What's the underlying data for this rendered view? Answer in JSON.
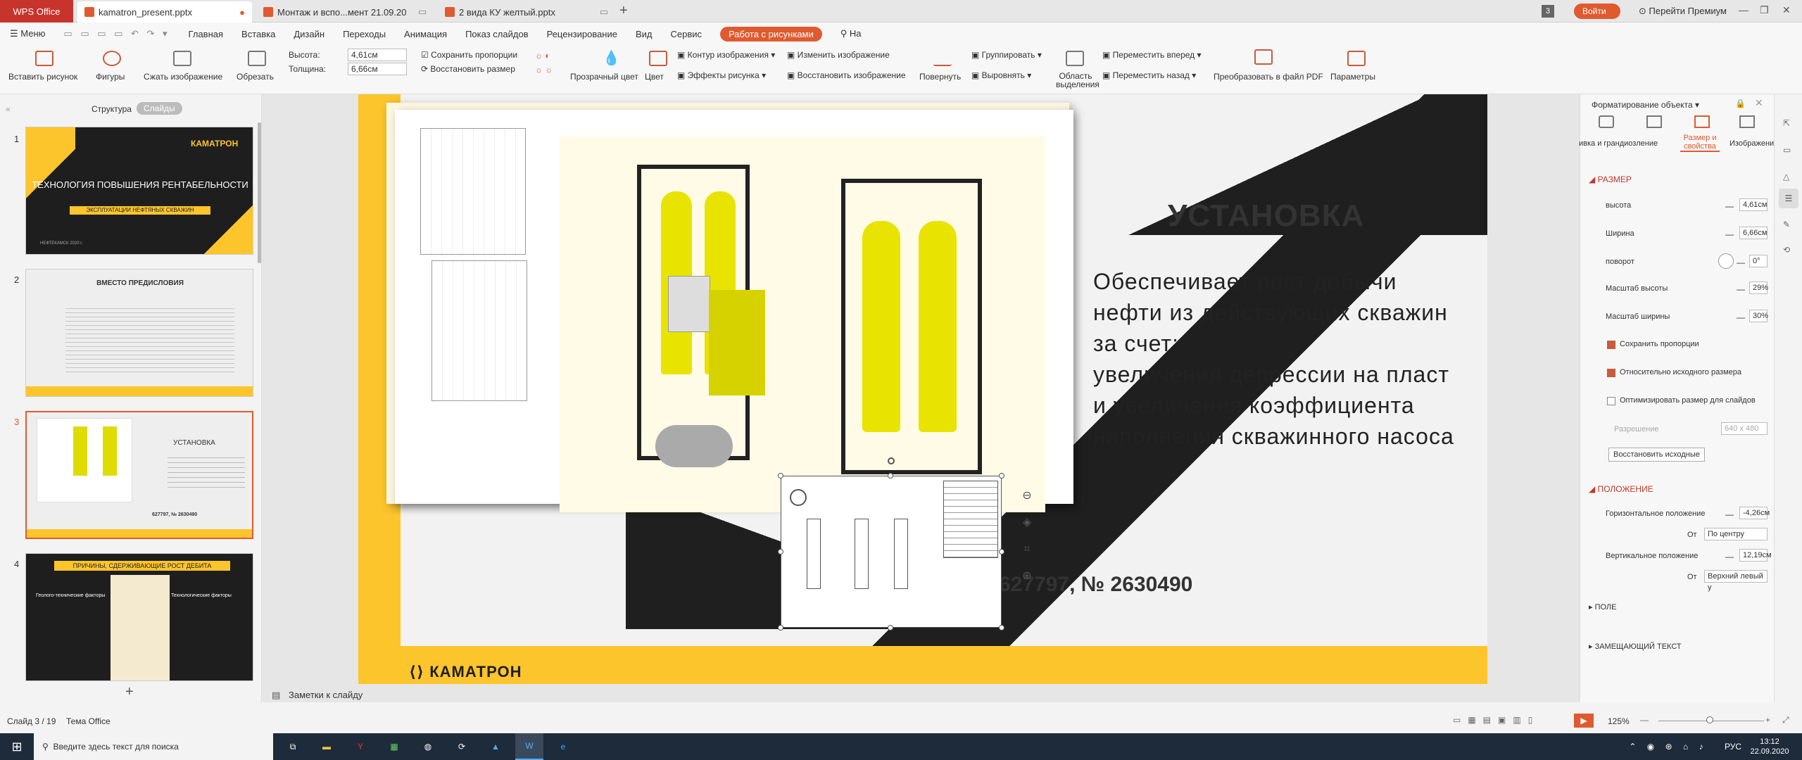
{
  "titlebar": {
    "app_name": "WPS Office",
    "tabs": [
      {
        "label": "kamatron_present.pptx",
        "active": true
      },
      {
        "label": "Монтаж и вспо...мент 21.09.20",
        "active": false
      },
      {
        "label": "2 вида КУ желтый.pptx",
        "active": false
      }
    ],
    "new_tab": "+",
    "tab_count": "3",
    "login_label": "Войти",
    "premium_label": "Перейти Премиум",
    "window_controls": [
      "—",
      "❐",
      "✕"
    ]
  },
  "menubar": {
    "menu_label": "Меню",
    "items": [
      "Главная",
      "Вставка",
      "Дизайн",
      "Переходы",
      "Анимация",
      "Показ слайдов",
      "Рецензирование",
      "Вид",
      "Сервис"
    ],
    "active_tab": "Работа с рисунками",
    "search_label": "На"
  },
  "toolbar": {
    "insert_picture": "Вставить рисунок",
    "shapes": "Фигуры",
    "compress": "Сжать изображение",
    "crop": "Обрезать",
    "height_label": "Высота:",
    "height_value": "4,61см",
    "width_label": "Толщина:",
    "width_value": "6,66см",
    "keep_ratio": "Сохранить пропорции",
    "restore_size": "Восстановить размер",
    "transparent": "Прозрачный цвет",
    "color": "Цвет",
    "outline": "Контур изображения",
    "effects": "Эффекты рисунка",
    "change_image": "Изменить изображение",
    "restore_image": "Восстановить изображение",
    "rotate": "Повернуть",
    "group": "Группировать",
    "align": "Выровнять",
    "selection_area": "Область выделения",
    "bring_forward": "Переместить вперед",
    "send_backward": "Переместить назад",
    "to_pdf": "Преобразовать в файл PDF",
    "params": "Параметры"
  },
  "leftpanel": {
    "tab_structure": "Структура",
    "tab_slides": "Слайды",
    "slides": [
      {
        "num": "1",
        "title": "ТЕХНОЛОГИЯ ПОВЫШЕНИЯ РЕНТАБЕЛЬНОСТИ",
        "sub": "ЭКСПЛУАТАЦИИ НЕФТЯНЫХ СКВАЖИН",
        "brand": "КАМАТРОН",
        "foot": "НЕФТЕКАМСК 2020 г."
      },
      {
        "num": "2",
        "title": "ВМЕСТО ПРЕДИСЛОВИЯ"
      },
      {
        "num": "3",
        "title": "УСТАНОВКА",
        "patent": "627797, № 2630490"
      },
      {
        "num": "4",
        "title": "ПРИЧИНЫ, СДЕРЖИВАЮЩИЕ РОСТ ДЕБИТА",
        "col1": "Геолого-технические факторы",
        "col2": "Технологические факторы"
      }
    ],
    "add": "+"
  },
  "slide": {
    "title": "УСТАНОВКА",
    "body_lines": [
      "Обеспечивает рост добычи",
      "нефти из действующих скважин",
      "за счет:",
      "увеличения депрессии на пласт",
      "и увеличения коэффициента",
      "наполнения скважинного насоса"
    ],
    "patent": "627797, № 2630490",
    "brand": "КАМАТРОН"
  },
  "rightpanel": {
    "title": "Форматирование объекта",
    "tabs": [
      "ивка и грандиозление",
      "Размер и свойства",
      "Изображение"
    ],
    "size_section": "РАЗМЕР",
    "height_label": "высота",
    "height_value": "4,61см",
    "width_label": "Ширина",
    "width_value": "6,66см",
    "rotation_label": "поворот",
    "rotation_value": "0°",
    "scale_h_label": "Масштаб высоты",
    "scale_h_value": "29%",
    "scale_w_label": "Масштаб ширины",
    "scale_w_value": "30%",
    "keep_ratio": "Сохранить пропорции",
    "relative_original": "Относительно исходного размера",
    "optimize": "Оптимизировать размер для слайдов",
    "resolution_label": "Разрешение",
    "resolution_value": "640 x 480",
    "restore_original": "Восстановить исходные",
    "position_section": "ПОЛОЖЕНИЕ",
    "horiz_label": "Горизонтальное положение",
    "horiz_value": "-4,26см",
    "from_label": "От",
    "horiz_from": "По центру",
    "vert_label": "Вертикальное положение",
    "vert_value": "12,19см",
    "vert_from": "Верхний левый у",
    "field_section": "ПОЛЕ",
    "alt_text_section": "ЗАМЕЩАЮЩИЙ ТЕКСТ"
  },
  "notes": {
    "label": "Заметки к слайду"
  },
  "statusbar": {
    "slide_counter": "Слайд 3 / 19",
    "theme": "Тема Office",
    "zoom": "125%"
  },
  "taskbar": {
    "search_placeholder": "Введите здесь текст для поиска",
    "time": "13:12",
    "date": "22.09.2020",
    "lang": "РУС"
  },
  "colors": {
    "wps_red": "#c7342c",
    "accent": "#e05a2f",
    "yellow": "#fdc52c",
    "dark": "#1f1f1f"
  }
}
